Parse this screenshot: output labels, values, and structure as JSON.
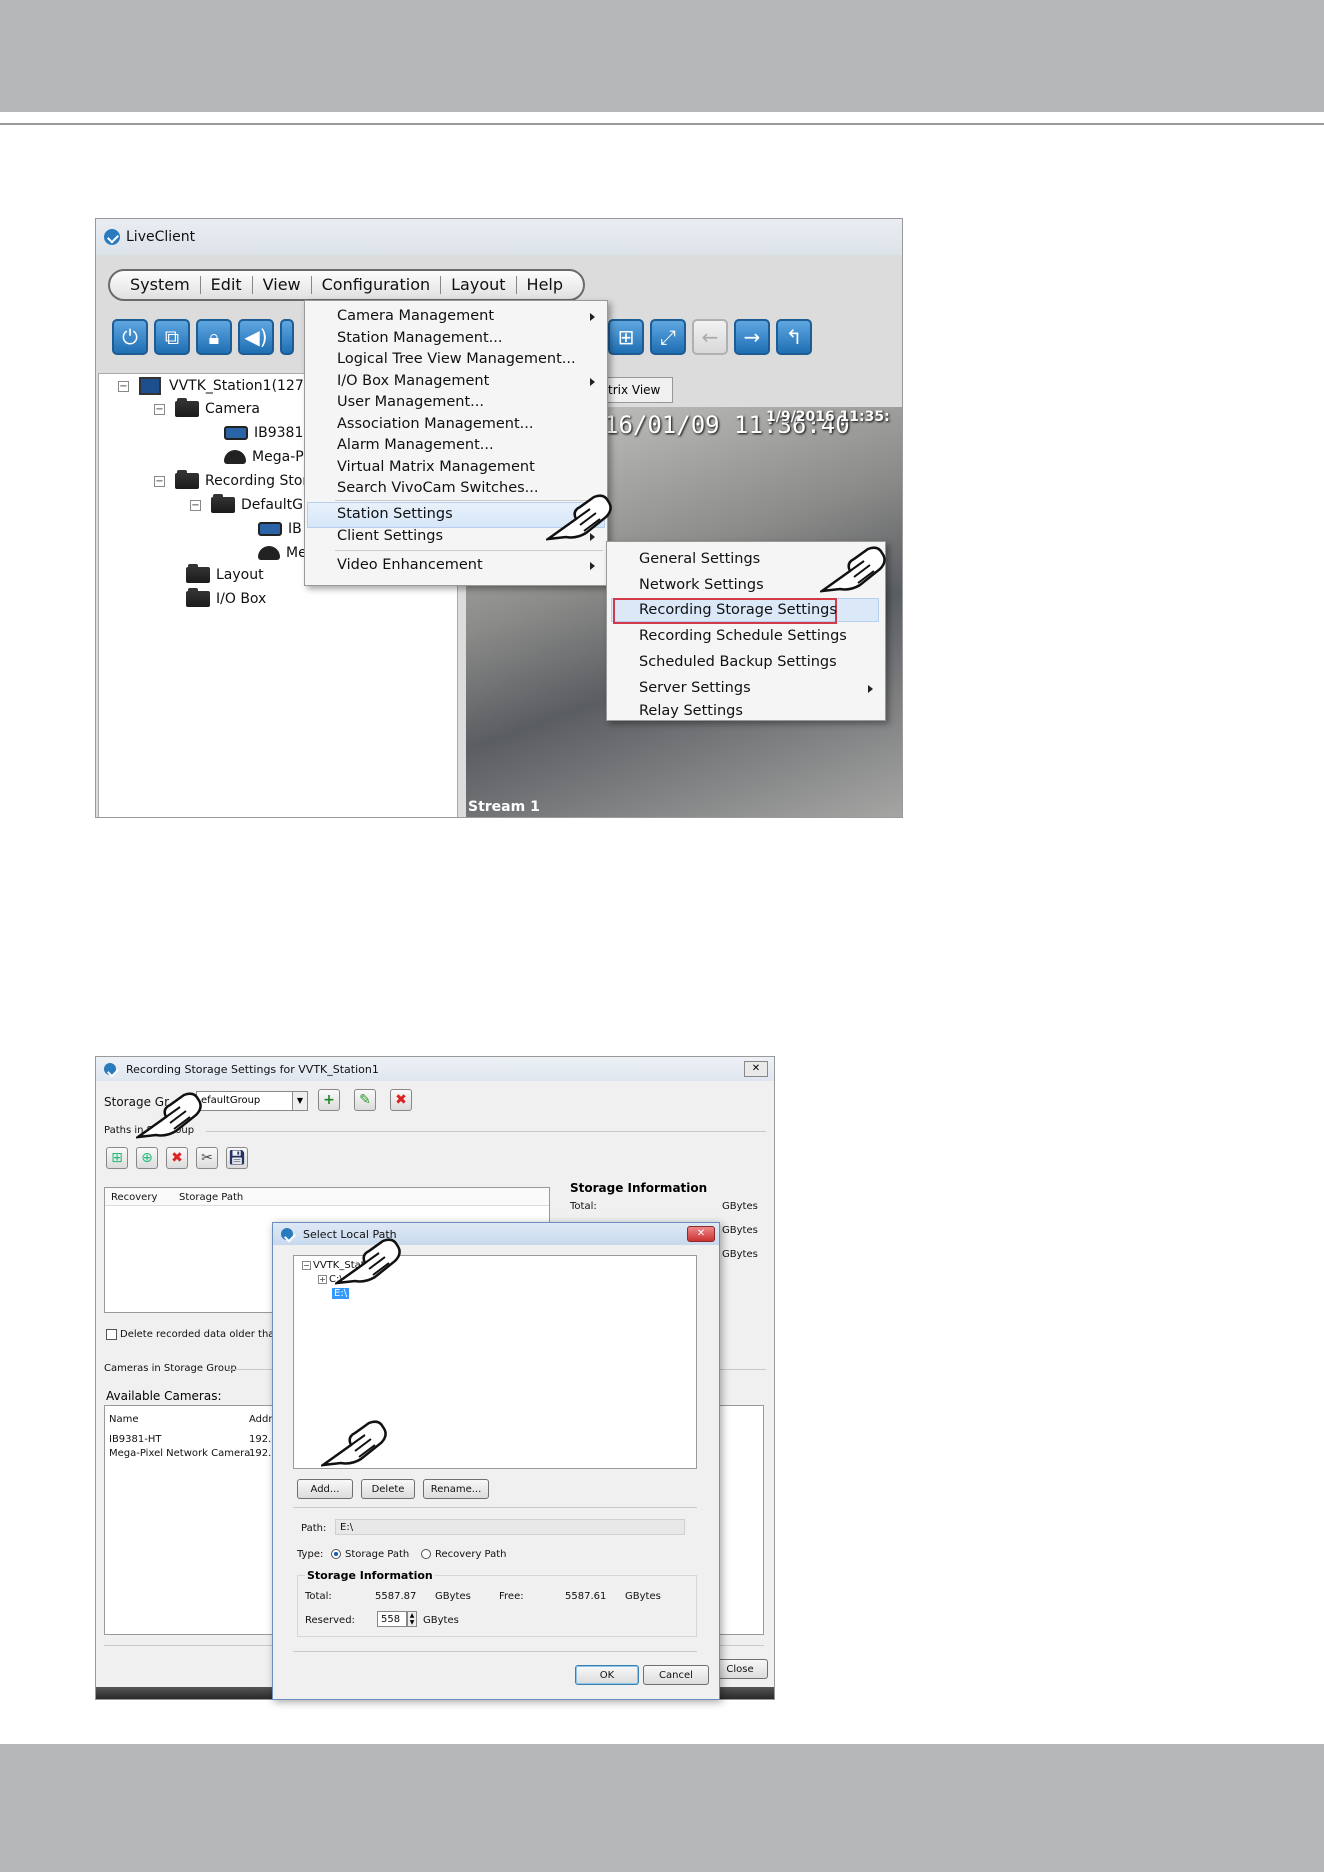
{
  "colors": {
    "band": "#b6b7b9",
    "accent": "#2a7bbd",
    "highlight_border": "#d23a4a",
    "selection": "#3399ff"
  },
  "shot1": {
    "title": "LiveClient",
    "menubar": [
      "System",
      "Edit",
      "View",
      "Configuration",
      "Layout",
      "Help"
    ],
    "toolbar_icons": [
      "power-icon",
      "network-icon",
      "lock-icon",
      "speaker-icon",
      "matrix-icon",
      "fullscreen-icon",
      "back-arrow-icon",
      "forward-arrow-icon",
      "return-icon"
    ],
    "tree": {
      "station": "VVTK_Station1(127.0",
      "camera": "Camera",
      "cam1": "IB9381-H",
      "cam2": "Mega-Pix",
      "recording": "Recording Stora",
      "group": "DefaultG",
      "gcam1": "IB",
      "gcam2": "Me",
      "layout": "Layout",
      "iobox": "I/O Box"
    },
    "tab": "trix View",
    "timestamp": "16/01/09 11:36:40",
    "timestamp2": "1/9/2016 11:35:",
    "stream": "Stream 1",
    "config_menu": [
      {
        "label": "Camera Management",
        "sub": true
      },
      {
        "label": "Station Management...",
        "sub": false
      },
      {
        "label": "Logical Tree View Management...",
        "sub": false
      },
      {
        "label": "I/O Box Management",
        "sub": true
      },
      {
        "label": "User Management...",
        "sub": false
      },
      {
        "label": "Association Management...",
        "sub": false
      },
      {
        "label": "Alarm Management...",
        "sub": false
      },
      {
        "label": "Virtual Matrix Management",
        "sub": false
      },
      {
        "label": "Search VivoCam Switches...",
        "sub": false
      },
      {
        "label": "Station Settings",
        "sub": true
      },
      {
        "label": "Client Settings",
        "sub": true
      },
      {
        "label": "Video Enhancement",
        "sub": true
      }
    ],
    "station_submenu": [
      "General Settings",
      "Network Settings",
      "Recording Storage Settings",
      "Recording Schedule Settings",
      "Scheduled Backup Settings",
      "Server Settings",
      "Relay Settings"
    ]
  },
  "shot2": {
    "title": "Recording Storage Settings for VVTK_Station1",
    "storage_group_label": "Storage Gr",
    "storage_group_value": "efaultGroup",
    "paths_label": "Paths in S",
    "paths_label2": "oup",
    "columns": [
      "Recovery",
      "Storage Path"
    ],
    "storage_info_title": "Storage Information",
    "total_label": "Total:",
    "gbytes": "GBytes",
    "delete_label": "Delete recorded data older than",
    "cameras_group": "Cameras in Storage Group",
    "available_cameras": "Available Cameras:",
    "cam_columns": [
      "Name",
      "Addr"
    ],
    "cameras": [
      {
        "name": "IB9381-HT",
        "addr": "192."
      },
      {
        "name": "Mega-Pixel Network Camera",
        "addr": "192."
      }
    ],
    "close": "Close"
  },
  "dialog": {
    "title": "Select Local Path",
    "tree_root": "VVTK_Statio",
    "drive_c": "C:\\",
    "drive_e": "E:\\",
    "add": "Add...",
    "delete": "Delete",
    "rename": "Rename...",
    "path_label": "Path:",
    "path_value": "E:\\",
    "type_label": "Type:",
    "storage_path": "Storage Path",
    "recovery_path": "Recovery Path",
    "info_title": "Storage Information",
    "total_label": "Total:",
    "total_value": "5587.87",
    "gbytes": "GBytes",
    "free_label": "Free:",
    "free_value": "5587.61",
    "reserved_label": "Reserved:",
    "reserved_value": "558",
    "ok": "OK",
    "cancel": "Cancel"
  }
}
